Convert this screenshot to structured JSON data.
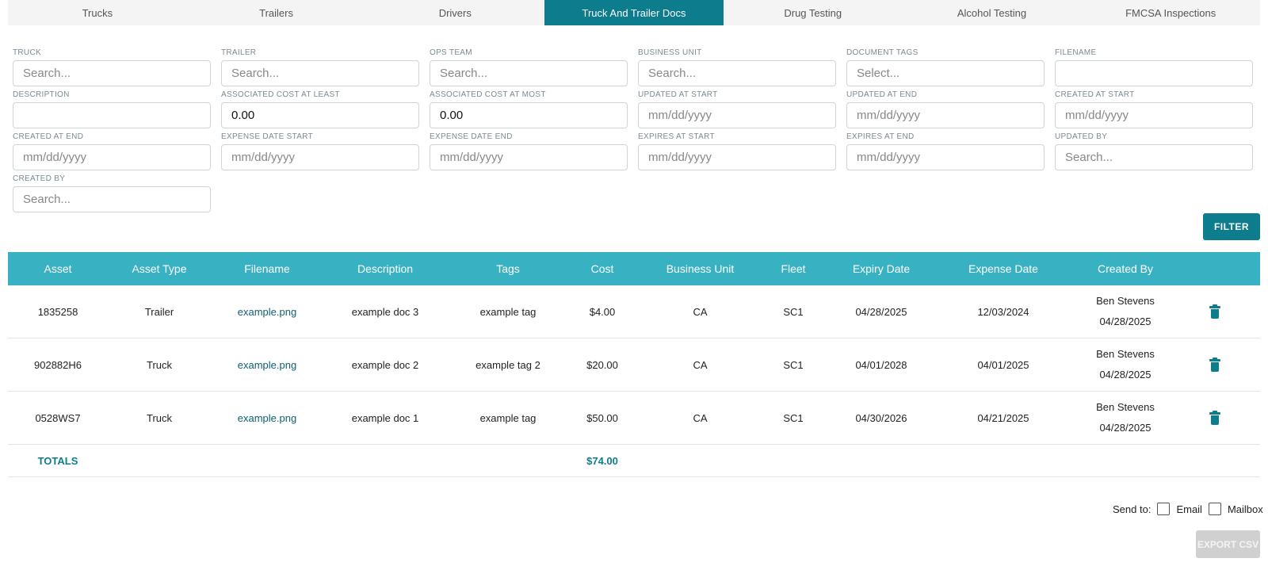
{
  "tabs": [
    {
      "label": "Trucks"
    },
    {
      "label": "Trailers"
    },
    {
      "label": "Drivers"
    },
    {
      "label": "Truck And Trailer Docs"
    },
    {
      "label": "Drug Testing"
    },
    {
      "label": "Alcohol Testing"
    },
    {
      "label": "FMCSA Inspections"
    }
  ],
  "active_tab": "Truck And Trailer Docs",
  "filters": [
    {
      "label": "TRUCK",
      "value": "",
      "placeholder": "Search..."
    },
    {
      "label": "TRAILER",
      "value": "",
      "placeholder": "Search..."
    },
    {
      "label": "OPS TEAM",
      "value": "",
      "placeholder": "Search..."
    },
    {
      "label": "BUSINESS UNIT",
      "value": "",
      "placeholder": "Search..."
    },
    {
      "label": "DOCUMENT TAGS",
      "value": "",
      "placeholder": "Select..."
    },
    {
      "label": "FILENAME",
      "value": "",
      "placeholder": ""
    },
    {
      "label": "DESCRIPTION",
      "value": "",
      "placeholder": ""
    },
    {
      "label": "ASSOCIATED COST AT LEAST",
      "value": "0.00",
      "placeholder": ""
    },
    {
      "label": "ASSOCIATED COST AT MOST",
      "value": "0.00",
      "placeholder": ""
    },
    {
      "label": "UPDATED AT START",
      "value": "",
      "placeholder": "mm/dd/yyyy"
    },
    {
      "label": "UPDATED AT END",
      "value": "",
      "placeholder": "mm/dd/yyyy"
    },
    {
      "label": "CREATED AT START",
      "value": "",
      "placeholder": "mm/dd/yyyy"
    },
    {
      "label": "CREATED AT END",
      "value": "",
      "placeholder": "mm/dd/yyyy"
    },
    {
      "label": "EXPENSE DATE START",
      "value": "",
      "placeholder": "mm/dd/yyyy"
    },
    {
      "label": "EXPENSE DATE END",
      "value": "",
      "placeholder": "mm/dd/yyyy"
    },
    {
      "label": "EXPIRES AT START",
      "value": "",
      "placeholder": "mm/dd/yyyy"
    },
    {
      "label": "EXPIRES AT END",
      "value": "",
      "placeholder": "mm/dd/yyyy"
    },
    {
      "label": "UPDATED BY",
      "value": "",
      "placeholder": "Search..."
    },
    {
      "label": "CREATED BY",
      "value": "",
      "placeholder": "Search..."
    }
  ],
  "filter_button": "FILTER",
  "table": {
    "columns": [
      "Asset",
      "Asset Type",
      "Filename",
      "Description",
      "Tags",
      "Cost",
      "Business Unit",
      "Fleet",
      "Expiry Date",
      "Expense Date",
      "Created By",
      ""
    ],
    "rows": [
      {
        "asset": "1835258",
        "asset_type": "Trailer",
        "filename": "example.png",
        "description": "example doc 3",
        "tags": "example tag",
        "cost": "$4.00",
        "business_unit": "CA",
        "fleet": "SC1",
        "expiry_date": "04/28/2025",
        "expense_date": "12/03/2024",
        "created_by": "Ben Stevens",
        "created_date": "04/28/2025",
        "action_icon": "trash-icon"
      },
      {
        "asset": "902882H6",
        "asset_type": "Truck",
        "filename": "example.png",
        "description": "example doc 2",
        "tags": "example tag 2",
        "cost": "$20.00",
        "business_unit": "CA",
        "fleet": "SC1",
        "expiry_date": "04/01/2028",
        "expense_date": "04/01/2025",
        "created_by": "Ben Stevens",
        "created_date": "04/28/2025",
        "action_icon": "trash-icon"
      },
      {
        "asset": "0528WS7",
        "asset_type": "Truck",
        "filename": "example.png",
        "description": "example doc 1",
        "tags": "example tag",
        "cost": "$50.00",
        "business_unit": "CA",
        "fleet": "SC1",
        "expiry_date": "04/30/2026",
        "expense_date": "04/21/2025",
        "created_by": "Ben Stevens",
        "created_date": "04/28/2025",
        "action_icon": "trash-icon"
      }
    ],
    "totals_label": "TOTALS",
    "totals_cost": "$74.00"
  },
  "send_to": {
    "label": "Send to:",
    "options": [
      {
        "label": "Email",
        "checked": false
      },
      {
        "label": "Mailbox",
        "checked": false
      }
    ]
  },
  "export_button": "EXPORT CSV",
  "colors": {
    "accent": "#0d7c8c",
    "table_header": "#38b2c2",
    "link": "#0d5f72",
    "disabled_button": "#d0d0d0"
  }
}
